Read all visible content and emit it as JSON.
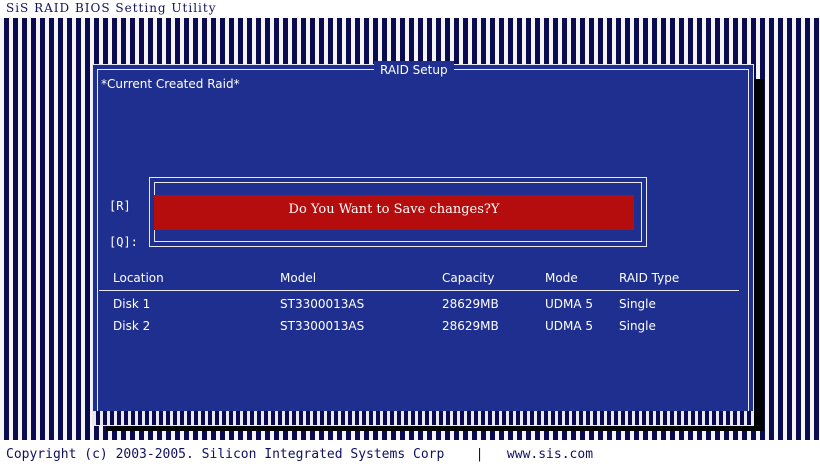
{
  "app": {
    "title": "SiS RAID BIOS Setting Utility",
    "footer_copyright": "Copyright (c) 2003-2005. Silicon Integrated Systems Corp",
    "footer_separator": "|",
    "footer_url": "www.sis.com"
  },
  "dialog": {
    "title": "RAID Setup",
    "section_label": "*Current Created Raid*",
    "key_r": "[R]",
    "key_q": "[Q]:",
    "confirm_prompt": "Do You Want to Save changes?Y"
  },
  "table": {
    "columns": [
      "Location",
      "Model",
      "Capacity",
      "Mode",
      "RAID Type"
    ],
    "rows": [
      {
        "location": "Disk 1",
        "model": "ST3300013AS",
        "capacity": "28629MB",
        "mode": "UDMA 5",
        "raid_type": "Single"
      },
      {
        "location": "Disk 2",
        "model": "ST3300013AS",
        "capacity": "28629MB",
        "mode": "UDMA 5",
        "raid_type": "Single"
      }
    ]
  },
  "colors": {
    "panel_blue": "#1f2f8f",
    "prompt_red": "#b50d0d",
    "stripe_dark": "#0a0a50",
    "text_white": "#ffffff"
  }
}
